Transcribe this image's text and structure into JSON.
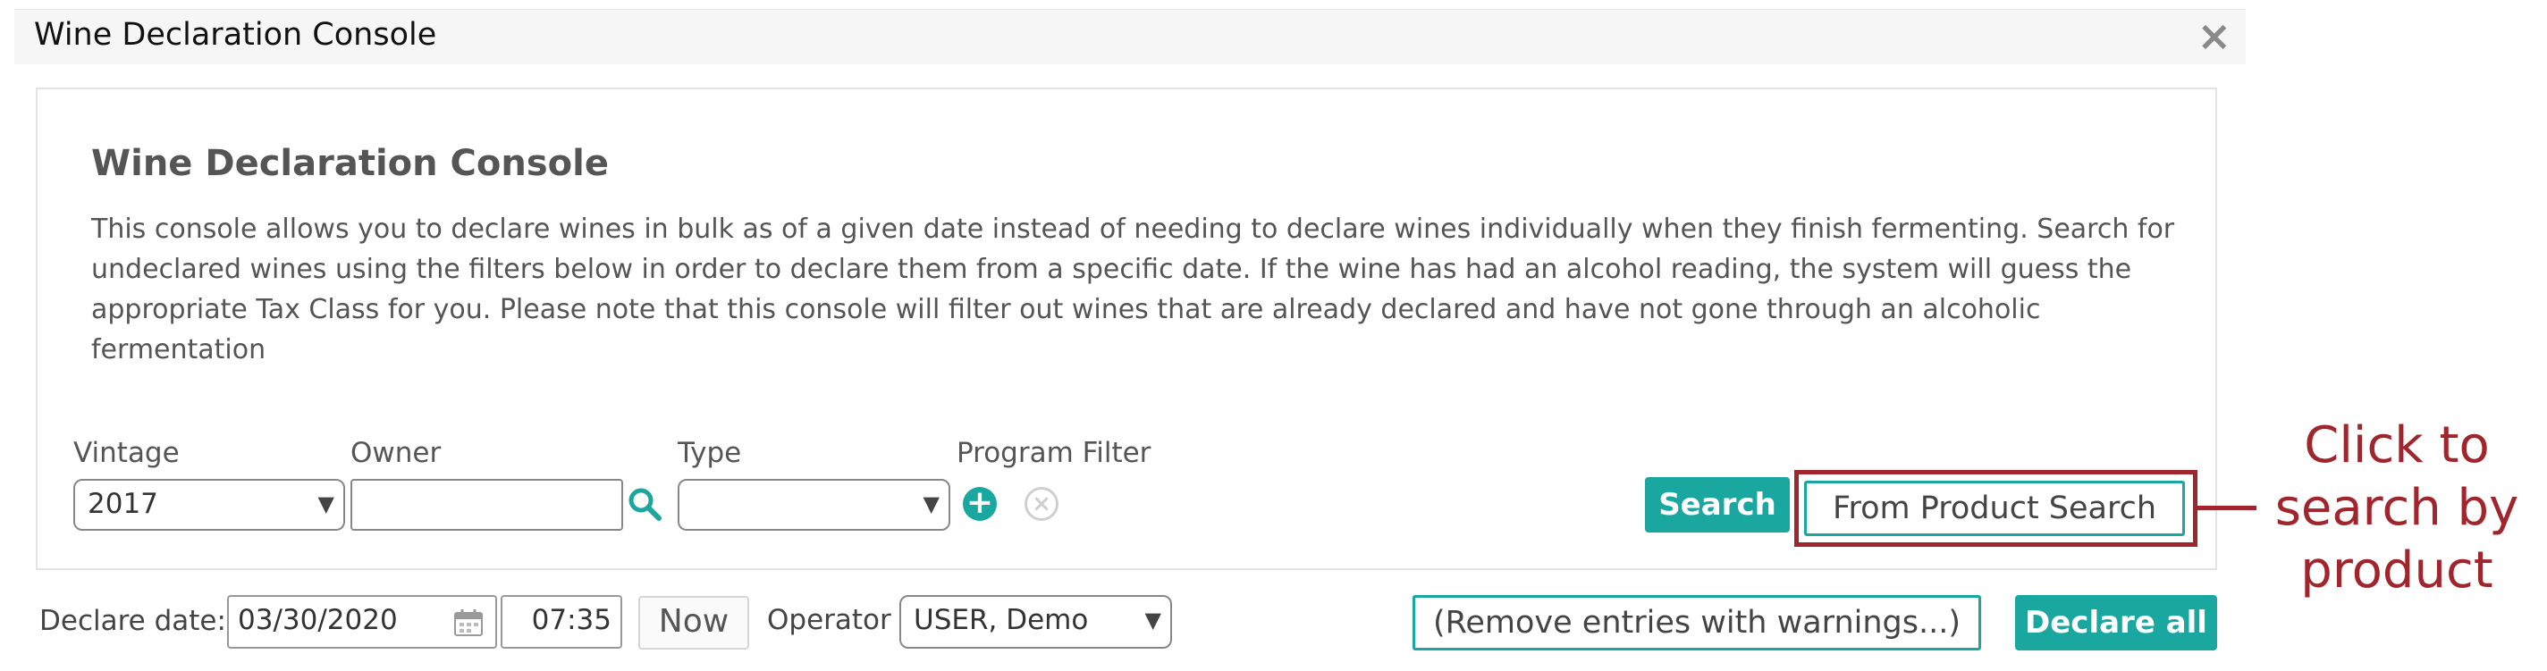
{
  "window": {
    "title": "Wine Declaration Console",
    "close_label": "×"
  },
  "panel": {
    "heading": "Wine Declaration Console",
    "description": "This console allows you to declare wines in bulk as of a given date instead of needing to declare wines individually when they finish fermenting. Search for undeclared wines using the filters below in order to declare them from a specific date. If the wine has had an alcohol reading, the system will guess the appropriate Tax Class for you. Please note that this console will filter out wines that are already declared and have not gone through an alcoholic fermentation"
  },
  "filters": {
    "vintage_label": "Vintage",
    "vintage_value": "2017",
    "owner_label": "Owner",
    "owner_value": "",
    "type_label": "Type",
    "type_value": "",
    "program_filter_label": "Program Filter"
  },
  "actions": {
    "search_label": "Search",
    "from_product_search_label": "From Product Search"
  },
  "footer": {
    "declare_date_label": "Declare date:",
    "date_value": "03/30/2020",
    "time_value": "07:35",
    "now_label": "Now",
    "operator_label": "Operator",
    "operator_value": "USER, Demo",
    "remove_warnings_label": "(Remove entries with warnings...)",
    "declare_all_label": "Declare all"
  },
  "annotation": {
    "callout_text": "Click to search by product"
  },
  "icons": {
    "close": "close-icon",
    "search": "search-icon",
    "add": "plus-circle-icon",
    "clear": "x-circle-icon",
    "calendar": "calendar-icon",
    "caret": "chevron-down-icon"
  },
  "colors": {
    "accent": "#1aa7a0",
    "annotation": "#a0252d"
  }
}
